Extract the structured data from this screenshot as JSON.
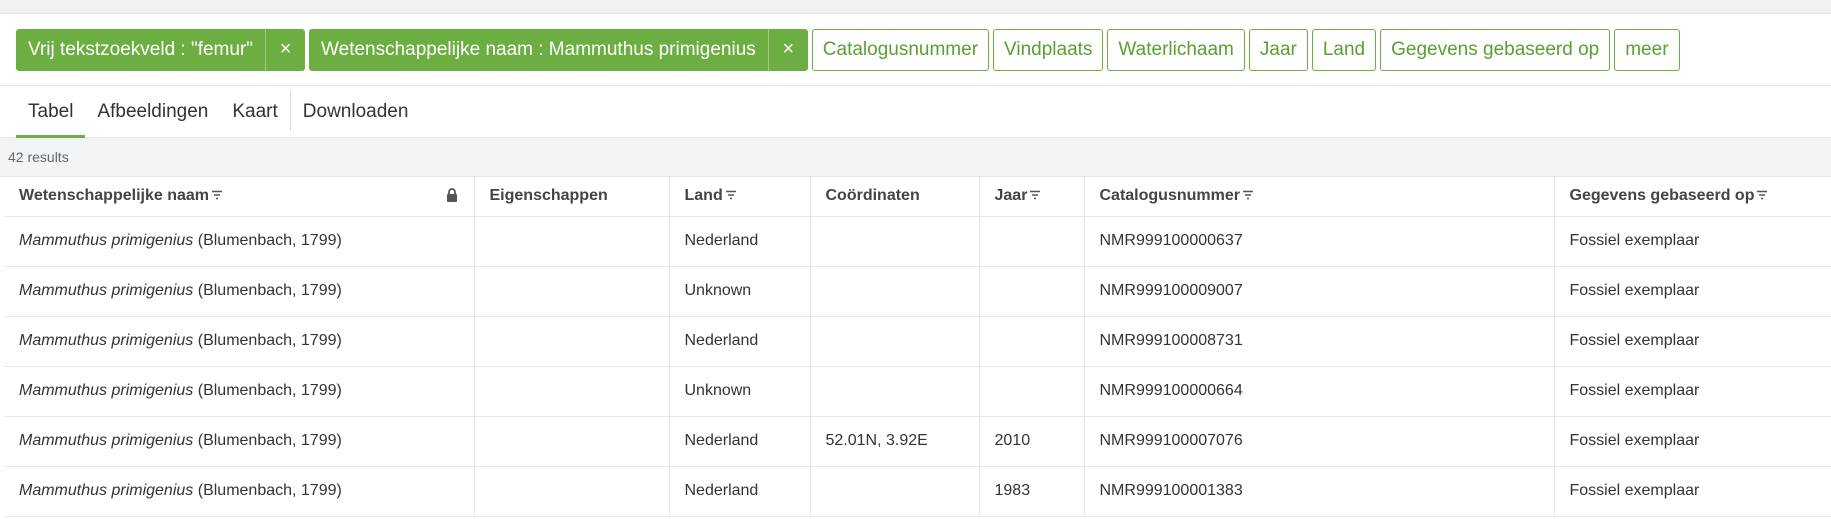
{
  "filters": {
    "active": [
      {
        "label": "Vrij tekstzoekveld : \"femur\"",
        "close": "×"
      },
      {
        "label": "Wetenschappelijke naam : Mammuthus primigenius",
        "close": "×"
      }
    ],
    "options": [
      "Catalogusnummer",
      "Vindplaats",
      "Waterlichaam",
      "Jaar",
      "Land",
      "Gegevens gebaseerd op",
      "meer"
    ]
  },
  "tabs": [
    "Tabel",
    "Afbeeldingen",
    "Kaart",
    "Downloaden"
  ],
  "active_tab": "Tabel",
  "results_count": "42 results",
  "table": {
    "columns": [
      "Wetenschappelijke naam",
      "Eigenschappen",
      "Land",
      "Coördinaten",
      "Jaar",
      "Catalogusnummer",
      "Gegevens gebaseerd op"
    ],
    "rows": [
      {
        "species": "Mammuthus primigenius",
        "author": "(Blumenbach, 1799)",
        "eigenschappen": "",
        "land": "Nederland",
        "coord": "",
        "jaar": "",
        "catalog": "NMR999100000637",
        "basis": "Fossiel exemplaar"
      },
      {
        "species": "Mammuthus primigenius",
        "author": "(Blumenbach, 1799)",
        "eigenschappen": "",
        "land": "Unknown",
        "coord": "",
        "jaar": "",
        "catalog": "NMR999100009007",
        "basis": "Fossiel exemplaar"
      },
      {
        "species": "Mammuthus primigenius",
        "author": "(Blumenbach, 1799)",
        "eigenschappen": "",
        "land": "Nederland",
        "coord": "",
        "jaar": "",
        "catalog": "NMR999100008731",
        "basis": "Fossiel exemplaar"
      },
      {
        "species": "Mammuthus primigenius",
        "author": "(Blumenbach, 1799)",
        "eigenschappen": "",
        "land": "Unknown",
        "coord": "",
        "jaar": "",
        "catalog": "NMR999100000664",
        "basis": "Fossiel exemplaar"
      },
      {
        "species": "Mammuthus primigenius",
        "author": "(Blumenbach, 1799)",
        "eigenschappen": "",
        "land": "Nederland",
        "coord": "52.01N, 3.92E",
        "jaar": "2010",
        "catalog": "NMR999100007076",
        "basis": "Fossiel exemplaar"
      },
      {
        "species": "Mammuthus primigenius",
        "author": "(Blumenbach, 1799)",
        "eigenschappen": "",
        "land": "Nederland",
        "coord": "",
        "jaar": "1983",
        "catalog": "NMR999100001383",
        "basis": "Fossiel exemplaar"
      }
    ]
  },
  "colors": {
    "accent": "#6dae42",
    "accent_text": "#5a9f32"
  },
  "icons": {
    "sort": "filter-sort-icon",
    "lock": "lock-icon",
    "close": "close-icon"
  }
}
